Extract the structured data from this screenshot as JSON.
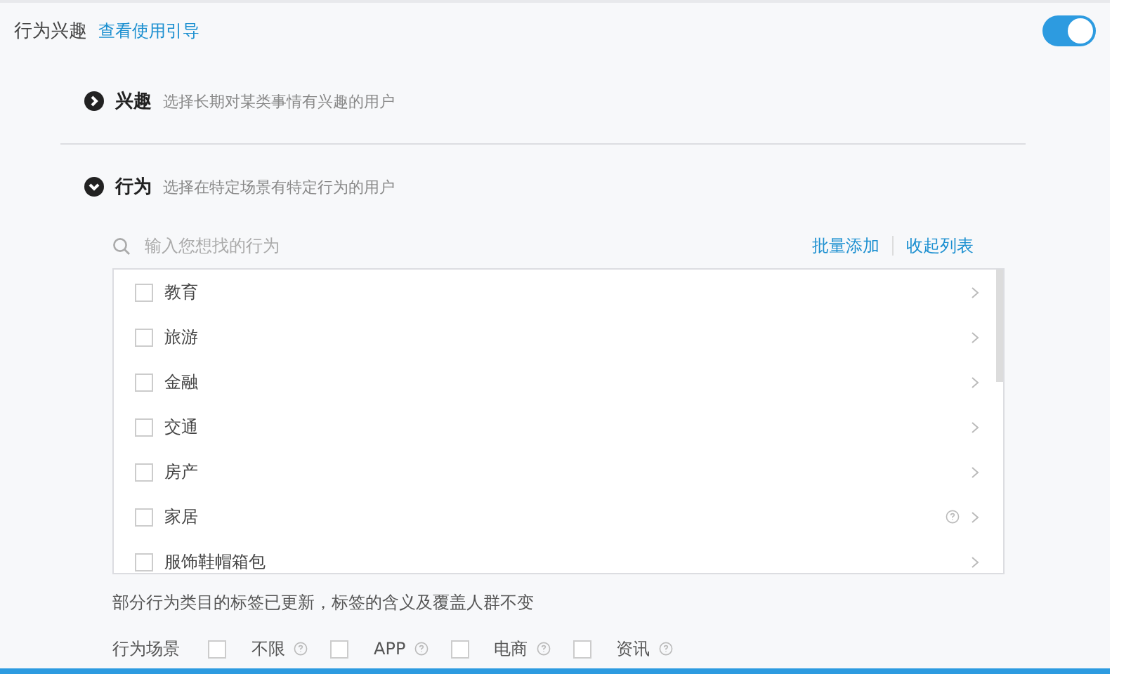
{
  "header": {
    "title": "行为兴趣",
    "guide_link": "查看使用引导",
    "toggle": {
      "on": true
    }
  },
  "sections": [
    {
      "title": "兴趣",
      "description": "选择长期对某类事情有兴趣的用户",
      "expanded": false
    },
    {
      "title": "行为",
      "description": "选择在特定场景有特定行为的用户",
      "expanded": true
    }
  ],
  "search": {
    "placeholder": "输入您想找的行为"
  },
  "actions": [
    "批量添加",
    "收起列表"
  ],
  "categories": [
    {
      "label": "教育",
      "checked": false,
      "help": false
    },
    {
      "label": "旅游",
      "checked": false,
      "help": false
    },
    {
      "label": "金融",
      "checked": false,
      "help": false
    },
    {
      "label": "交通",
      "checked": false,
      "help": false
    },
    {
      "label": "房产",
      "checked": false,
      "help": false
    },
    {
      "label": "家居",
      "checked": false,
      "help": true
    },
    {
      "label": "服饰鞋帽箱包",
      "checked": false,
      "help": false
    }
  ],
  "note": "部分行为类目的标签已更新，标签的含义及覆盖人群不变",
  "scenes": {
    "label": "行为场景",
    "options": [
      {
        "label": "不限",
        "checked": false
      },
      {
        "label": "APP",
        "checked": false
      },
      {
        "label": "电商",
        "checked": false
      },
      {
        "label": "资讯",
        "checked": false
      }
    ]
  }
}
